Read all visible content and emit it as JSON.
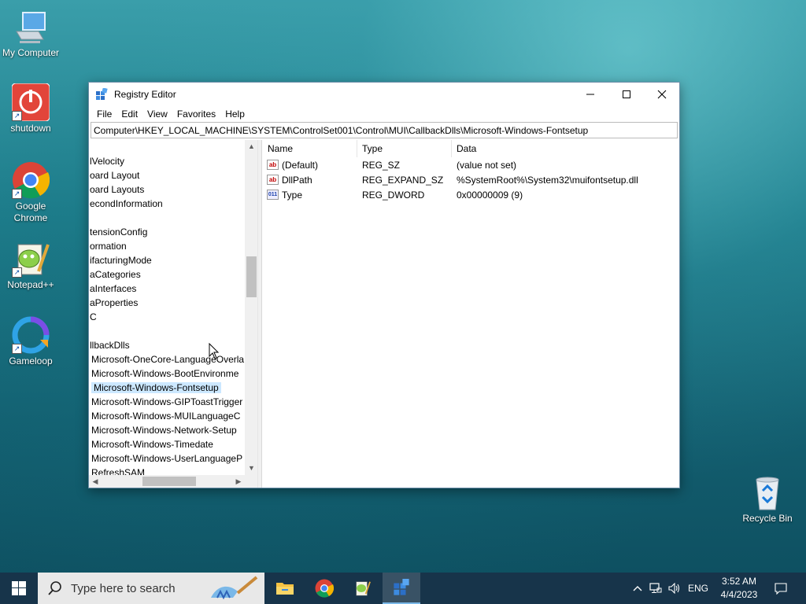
{
  "desktop": {
    "icons": [
      {
        "label": "My Computer"
      },
      {
        "label": "shutdown"
      },
      {
        "label": "Google Chrome"
      },
      {
        "label": "Notepad++"
      },
      {
        "label": "Gameloop"
      },
      {
        "label": "Recycle Bin"
      }
    ]
  },
  "window": {
    "title": "Registry Editor",
    "menu": [
      "File",
      "Edit",
      "View",
      "Favorites",
      "Help"
    ],
    "address": "Computer\\HKEY_LOCAL_MACHINE\\SYSTEM\\ControlSet001\\Control\\MUI\\CallbackDlls\\Microsoft-Windows-Fontsetup",
    "tree": [
      "lVelocity",
      "oard Layout",
      "oard Layouts",
      "econdInformation",
      "",
      "tensionConfig",
      "ormation",
      "ifacturingMode",
      "aCategories",
      "aInterfaces",
      "aProperties",
      "C",
      "",
      "llbackDlls",
      "Microsoft-OneCore-LanguageOverla",
      "Microsoft-Windows-BootEnvironme",
      "Microsoft-Windows-Fontsetup",
      "Microsoft-Windows-GIPToastTrigger",
      "Microsoft-Windows-MUILanguageC",
      "Microsoft-Windows-Network-Setup",
      "Microsoft-Windows-Timedate",
      "Microsoft-Windows-UserLanguageP",
      "RefreshSAM"
    ],
    "selected_tree_item": "Microsoft-Windows-Fontsetup",
    "columns": {
      "name": "Name",
      "type": "Type",
      "data": "Data"
    },
    "values": [
      {
        "name": "(Default)",
        "type": "REG_SZ",
        "data": "(value not set)",
        "icon": "string-value-icon"
      },
      {
        "name": "DllPath",
        "type": "REG_EXPAND_SZ",
        "data": "%SystemRoot%\\System32\\muifontsetup.dll",
        "icon": "string-value-icon"
      },
      {
        "name": "Type",
        "type": "REG_DWORD",
        "data": "0x00000009 (9)",
        "icon": "dword-value-icon"
      }
    ]
  },
  "taskbar": {
    "search_placeholder": "Type here to search",
    "language": "ENG",
    "time": "3:52 AM",
    "date": "4/4/2023"
  },
  "colors": {
    "selection": "#cce8ff",
    "taskbar": "#17344a",
    "active_app_underline": "#7ab8e8"
  }
}
